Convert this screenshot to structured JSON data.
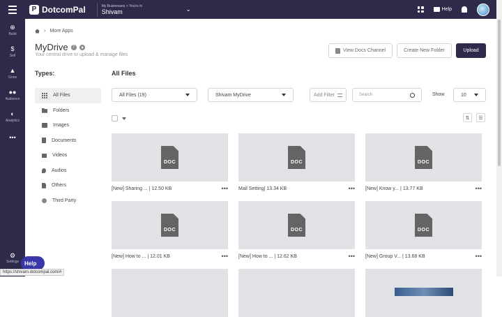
{
  "topbar": {
    "brand": "DotcomPal",
    "business_caption": "My Businesses > You're In",
    "business_name": "Shivam",
    "help_label": "Help"
  },
  "sidebar": {
    "items": [
      {
        "label": "Build",
        "icon": "plus-circle-icon"
      },
      {
        "label": "Sell",
        "icon": "dollar-icon"
      },
      {
        "label": "Grow",
        "icon": "grow-icon"
      },
      {
        "label": "Audience",
        "icon": "people-icon"
      },
      {
        "label": "Analytics",
        "icon": "analytics-icon"
      },
      {
        "label": "",
        "icon": "more-dots-icon"
      }
    ],
    "settings_label": "Settings"
  },
  "breadcrumb": {
    "current": "More Apps"
  },
  "page": {
    "title": "MyDrive",
    "subtitle": "Your central drive to upload & manage files"
  },
  "actions": {
    "view_docs": "View Docs Channel",
    "create_folder": "Create New Folder",
    "upload": "Upload"
  },
  "types": {
    "title": "Types:",
    "items": [
      {
        "label": "All Files",
        "active": true
      },
      {
        "label": "Folders"
      },
      {
        "label": "Images"
      },
      {
        "label": "Documents"
      },
      {
        "label": "Videos"
      },
      {
        "label": "Audios"
      },
      {
        "label": "Others"
      },
      {
        "label": "Third Party"
      }
    ]
  },
  "files": {
    "title": "All Files",
    "filter_all": "All Files (19)",
    "filter_drive": "Shivam MyDrive",
    "add_filter": "Add Filter",
    "search_placeholder": "Search",
    "show_label": "Show",
    "show_value": "10",
    "items": [
      {
        "name": "[New] Sharing ... | 12.50 KB",
        "type": "DOC"
      },
      {
        "name": "Mail Setting| 13.34 KB",
        "type": "DOC"
      },
      {
        "name": "[New] Know y... | 13.77 KB",
        "type": "DOC"
      },
      {
        "name": "[New] How to ... | 12.01 KB",
        "type": "DOC"
      },
      {
        "name": "[New] How to ... | 12.62 KB",
        "type": "DOC"
      },
      {
        "name": "[New] Group V... | 13.68 KB",
        "type": "DOC"
      }
    ]
  },
  "help_fab": "Help",
  "status_url": "https://shivam.dotcompal.com/#"
}
